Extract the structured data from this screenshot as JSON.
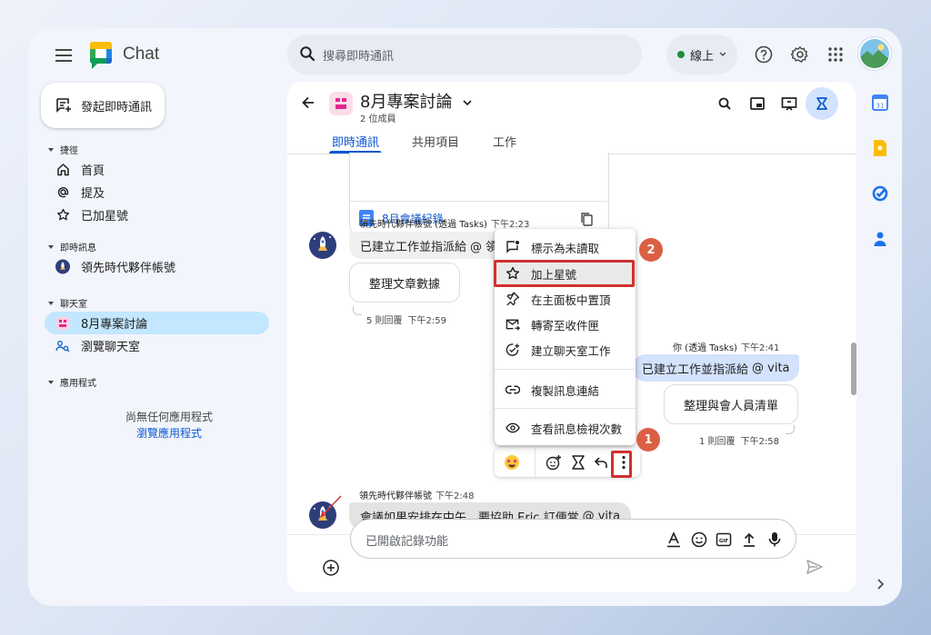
{
  "header": {
    "app_title": "Chat",
    "search_placeholder": "搜尋即時通訊",
    "status": "線上"
  },
  "sidebar": {
    "new_chat": "發起即時通訊",
    "shortcuts_title": "捷徑",
    "shortcuts": [
      "首頁",
      "提及",
      "已加星號"
    ],
    "dm_title": "即時訊息",
    "dms": [
      "領先時代夥伴帳號"
    ],
    "spaces_title": "聊天室",
    "spaces": [
      "8月專案討論",
      "瀏覽聊天室"
    ],
    "apps_title": "應用程式",
    "apps_empty": "尚無任何應用程式",
    "apps_browse": "瀏覽應用程式"
  },
  "room": {
    "name": "8月專案討論",
    "members": "2 位成員",
    "tabs": [
      "即時通訊",
      "共用項目",
      "工作"
    ]
  },
  "messages": {
    "doc_card": "8月會議紀錄",
    "msg1_sender": "領先時代夥伴帳號 (透過 Tasks)",
    "msg1_time": "下午2:23",
    "msg1_text": "已建立工作並指派給",
    "msg1_mention": "@ 領",
    "msg1_card": "整理文章數據",
    "msg1_replies": "5 則回覆",
    "msg1_reply_time": "下午2:59",
    "msg2_sender": "你 (透過 Tasks)",
    "msg2_time": "下午2:41",
    "msg2_text": "已建立工作並指派給",
    "msg2_mention": "@ vita",
    "msg2_card": "整理與會人員清單",
    "msg2_replies": "1 則回覆",
    "msg2_reply_time": "下午2:58",
    "msg3_sender": "領先時代夥伴帳號",
    "msg3_time": "下午2:48",
    "msg3_text": "會議如果安排在中午，要協助 Eric 訂便當",
    "msg3_mention": "@ vita"
  },
  "context_menu": [
    "標示為未讀取",
    "加上星號",
    "在主面板中置頂",
    "轉寄至收件匣",
    "建立聊天室工作",
    "複製訊息連結",
    "查看訊息檢視次數"
  ],
  "badges": [
    "1",
    "2"
  ],
  "composer": {
    "placeholder": "已開啟記錄功能"
  },
  "colors": {
    "accent": "#0b57d0",
    "selected": "#c2e7ff",
    "highlight_red": "#d32f2f",
    "badge": "#db5f44"
  }
}
